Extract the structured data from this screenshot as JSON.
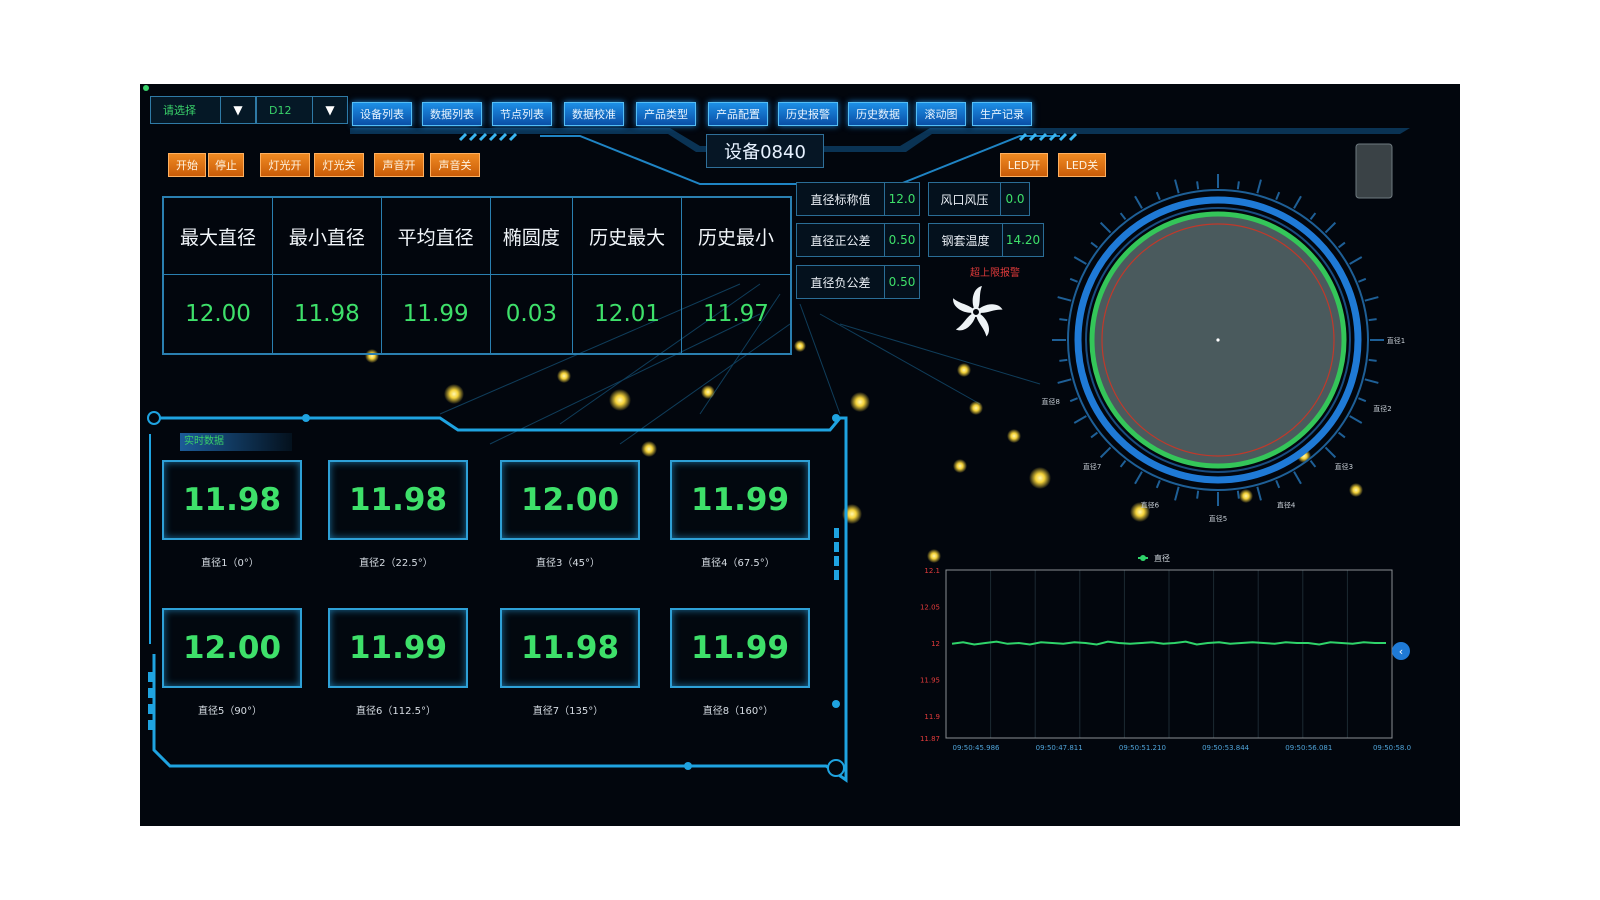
{
  "toolbar": {
    "selector1_value": "请选择",
    "selector2_value": "D12",
    "dropdown_glyph": "▼",
    "nav_buttons": [
      "设备列表",
      "数据列表",
      "节点列表",
      "数据校准",
      "产品类型",
      "产品配置",
      "历史报警",
      "历史数据",
      "滚动图",
      "生产记录"
    ]
  },
  "controls": {
    "left_buttons": [
      "开始",
      "停止",
      "灯光开",
      "灯光关",
      "声音开",
      "声音关"
    ],
    "right_buttons": [
      "LED开",
      "LED关"
    ]
  },
  "device_title": "设备0840",
  "stats": {
    "headers": [
      "最大直径",
      "最小直径",
      "平均直径",
      "椭圆度",
      "历史最大",
      "历史最小"
    ],
    "values": [
      "12.00",
      "11.98",
      "11.99",
      "0.03",
      "12.01",
      "11.97"
    ]
  },
  "params": {
    "std_label": "直径标称值",
    "std_value": "12.0",
    "pos_label": "直径正公差",
    "pos_value": "0.50",
    "neg_label": "直径负公差",
    "neg_value": "0.50",
    "wind_label": "风口风压",
    "wind_value": "0.0",
    "temp_label": "钢套温度",
    "temp_value": "14.20",
    "alarm_text": "超上限报警"
  },
  "realtime": {
    "tag": "实时数据",
    "tiles": [
      {
        "value": "11.98",
        "label": "直径1（0°）"
      },
      {
        "value": "11.98",
        "label": "直径2（22.5°）"
      },
      {
        "value": "12.00",
        "label": "直径3（45°）"
      },
      {
        "value": "11.99",
        "label": "直径4（67.5°）"
      },
      {
        "value": "12.00",
        "label": "直径5（90°）"
      },
      {
        "value": "11.99",
        "label": "直径6（112.5°）"
      },
      {
        "value": "11.98",
        "label": "直径7（135°）"
      },
      {
        "value": "11.99",
        "label": "直径8（160°）"
      }
    ]
  },
  "gauge": {
    "labels": [
      "直径1",
      "直径2",
      "直径3",
      "直径4",
      "直径5",
      "直径6",
      "直径7",
      "直径8"
    ]
  },
  "chart_data": {
    "type": "line",
    "legend": "直径",
    "ylim": [
      11.87,
      12.1
    ],
    "yticks": [
      "12.1",
      "12.05",
      "12",
      "11.95",
      "11.9",
      "11.87"
    ],
    "xticks": [
      "09:50:45.986",
      "09:50:47.811",
      "09:50:51.210",
      "09:50:53.844",
      "09:50:56.081",
      "09:50:58.0"
    ],
    "series": [
      {
        "name": "直径",
        "values": [
          11.999,
          12.001,
          11.998,
          12.0,
          12.002,
          11.999,
          12.0,
          11.998,
          12.001,
          12.0,
          11.999,
          12.001,
          12.0,
          11.998,
          12.002,
          12.0,
          11.999,
          12.0,
          12.001,
          11.999,
          12.0,
          12.002,
          11.998,
          12.0,
          12.001,
          11.999,
          12.0,
          12.001,
          12.0,
          11.999,
          12.001,
          12.0,
          12.0,
          11.998,
          12.001,
          12.0,
          11.999,
          12.001,
          12.0,
          12.0
        ]
      }
    ],
    "colors": {
      "line": "#2fd46a",
      "axis_text": "#e23b3b"
    }
  }
}
